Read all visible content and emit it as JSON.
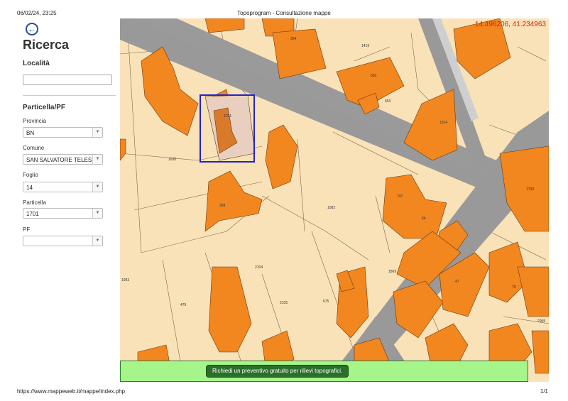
{
  "print": {
    "datetime": "06/02/24, 23:25",
    "title": "Topoprogram - Consultazione mappe",
    "url": "https://www.mappeweb.it/mappe/index.php",
    "page": "1/1"
  },
  "sidebar": {
    "title": "Ricerca",
    "back_icon": "back-arrow-icon",
    "localita": {
      "label": "Località",
      "value": "",
      "placeholder": ""
    },
    "particella_section": "Particella/PF",
    "fields": [
      {
        "label": "Provincia",
        "value": "BN"
      },
      {
        "label": "Comune",
        "value": "SAN SALVATORE TELESINO"
      },
      {
        "label": "Foglio",
        "value": "14"
      },
      {
        "label": "Particella",
        "value": "1701"
      },
      {
        "label": "PF",
        "value": ""
      }
    ]
  },
  "map": {
    "coordinates": "14.496206, 41.234963",
    "banner_button": "Richiedi un preventivo gratuito per rilievi topografici.",
    "parcel_labels": [
      "1701",
      "1695",
      "364",
      "1419",
      "693",
      "1324",
      "653",
      "369",
      "1082",
      "1869",
      "2104",
      "2105",
      "1993",
      "479",
      "675",
      "747",
      "64",
      "1709",
      "2005",
      "47",
      "70"
    ],
    "colors": {
      "building": "#f2861f",
      "land": "#fae2b8",
      "road": "#999999",
      "selection": "#2222cc",
      "coords": "#e0201a"
    }
  }
}
